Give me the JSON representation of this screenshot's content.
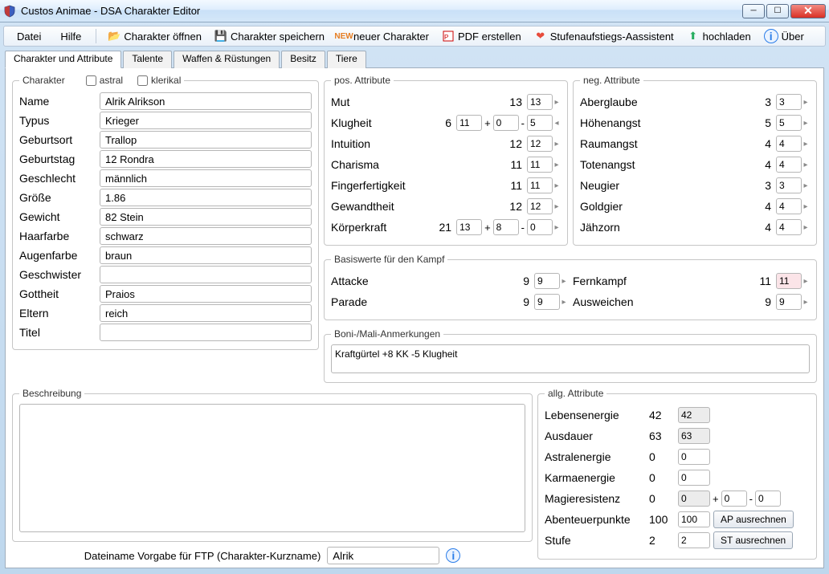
{
  "window": {
    "title": "Custos Animae - DSA Charakter Editor"
  },
  "menu": {
    "datei": "Datei",
    "hilfe": "Hilfe"
  },
  "toolbar": {
    "open": "Charakter öffnen",
    "save": "Charakter speichern",
    "new": "neuer Charakter",
    "pdf": "PDF erstellen",
    "levelup": "Stufenaufstiegs-Aassistent",
    "upload": "hochladen",
    "about": "Über"
  },
  "tabs": [
    "Charakter und Attribute",
    "Talente",
    "Waffen & Rüstungen",
    "Besitz",
    "Tiere"
  ],
  "charakter": {
    "legend": "Charakter",
    "astral_label": "astral",
    "klerikal_label": "klerikal",
    "astral_checked": false,
    "klerikal_checked": false,
    "fields": {
      "name": {
        "label": "Name",
        "value": "Alrik Alrikson"
      },
      "typus": {
        "label": "Typus",
        "value": "Krieger"
      },
      "geburtsort": {
        "label": "Geburtsort",
        "value": "Trallop"
      },
      "geburtstag": {
        "label": "Geburtstag",
        "value": "12 Rondra"
      },
      "geschlecht": {
        "label": "Geschlecht",
        "value": "männlich"
      },
      "groesse": {
        "label": "Größe",
        "value": "1.86"
      },
      "gewicht": {
        "label": "Gewicht",
        "value": "82 Stein"
      },
      "haarfarbe": {
        "label": "Haarfarbe",
        "value": "schwarz"
      },
      "augenfarbe": {
        "label": "Augenfarbe",
        "value": "braun"
      },
      "geschwister": {
        "label": "Geschwister",
        "value": ""
      },
      "gottheit": {
        "label": "Gottheit",
        "value": "Praios"
      },
      "eltern": {
        "label": "Eltern",
        "value": "reich"
      },
      "titel": {
        "label": "Titel",
        "value": ""
      }
    }
  },
  "pos_attr": {
    "legend": "pos. Attribute",
    "rows": [
      {
        "name": "Mut",
        "val": "13",
        "box": "13"
      },
      {
        "name": "Klugheit",
        "val": "6",
        "box": "11",
        "plus": "0",
        "minus": "5",
        "left_arrow": true
      },
      {
        "name": "Intuition",
        "val": "12",
        "box": "12"
      },
      {
        "name": "Charisma",
        "val": "11",
        "box": "11"
      },
      {
        "name": "Fingerfertigkeit",
        "val": "11",
        "box": "11"
      },
      {
        "name": "Gewandtheit",
        "val": "12",
        "box": "12"
      },
      {
        "name": "Körperkraft",
        "val": "21",
        "box": "13",
        "plus": "8",
        "minus": "0"
      }
    ]
  },
  "neg_attr": {
    "legend": "neg. Attribute",
    "rows": [
      {
        "name": "Aberglaube",
        "val": "3",
        "box": "3"
      },
      {
        "name": "Höhenangst",
        "val": "5",
        "box": "5"
      },
      {
        "name": "Raumangst",
        "val": "4",
        "box": "4"
      },
      {
        "name": "Totenangst",
        "val": "4",
        "box": "4"
      },
      {
        "name": "Neugier",
        "val": "3",
        "box": "3"
      },
      {
        "name": "Goldgier",
        "val": "4",
        "box": "4"
      },
      {
        "name": "Jähzorn",
        "val": "4",
        "box": "4"
      }
    ]
  },
  "combat": {
    "legend": "Basiswerte für den Kampf",
    "at": {
      "name": "Attacke",
      "val": "9",
      "box": "9"
    },
    "pa": {
      "name": "Parade",
      "val": "9",
      "box": "9"
    },
    "fk": {
      "name": "Fernkampf",
      "val": "11",
      "box": "11",
      "pink": true
    },
    "aw": {
      "name": "Ausweichen",
      "val": "9",
      "box": "9"
    }
  },
  "boni": {
    "legend": "Boni-/Mali-Anmerkungen",
    "text": "Kraftgürtel +8 KK -5 Klugheit"
  },
  "beschreibung": {
    "legend": "Beschreibung",
    "text": ""
  },
  "allg": {
    "legend": "allg. Attribute",
    "le": {
      "name": "Lebensenergie",
      "val": "42",
      "box": "42",
      "gray": true
    },
    "au": {
      "name": "Ausdauer",
      "val": "63",
      "box": "63",
      "gray": true
    },
    "ae": {
      "name": "Astralenergie",
      "val": "0",
      "box": "0"
    },
    "ke": {
      "name": "Karmaenergie",
      "val": "0",
      "box": "0"
    },
    "mr": {
      "name": "Magieresistenz",
      "val": "0",
      "box": "0",
      "gray": true,
      "plus": "0",
      "minus": "0"
    },
    "ap": {
      "name": "Abenteuerpunkte",
      "val": "100",
      "box": "100",
      "btn": "AP ausrechnen"
    },
    "st": {
      "name": "Stufe",
      "val": "2",
      "box": "2",
      "btn": "ST ausrechnen"
    }
  },
  "ftp": {
    "label": "Dateiname Vorgabe für FTP (Charakter-Kurzname)",
    "value": "Alrik"
  }
}
